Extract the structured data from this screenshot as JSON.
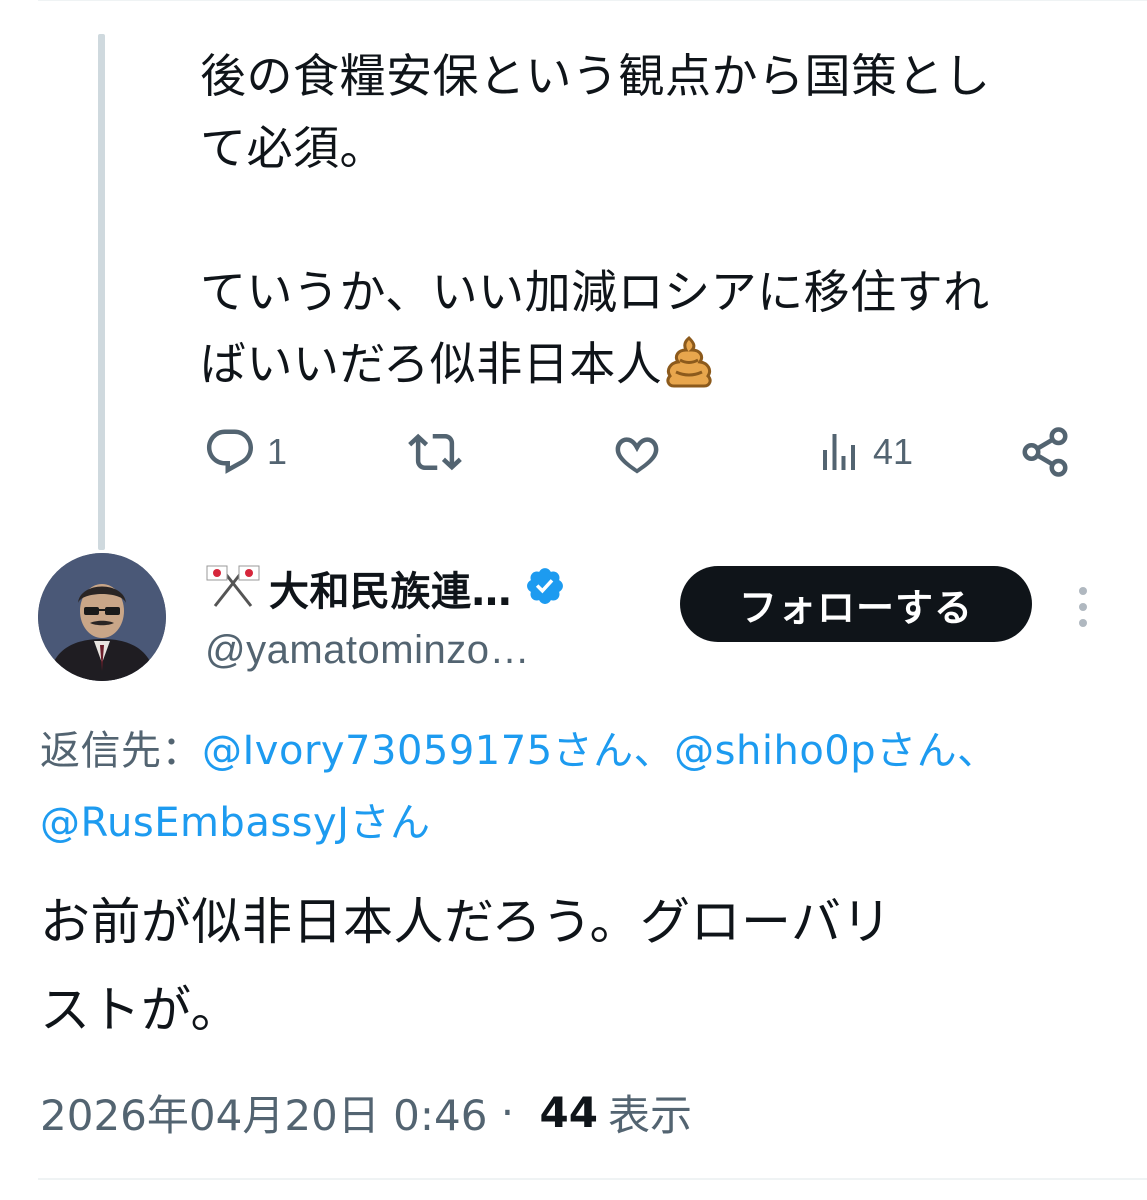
{
  "previous_tweet": {
    "text_lines": [
      "後の食糧安保という観点から国策とし",
      "て必須。",
      "",
      "ていうか、いい加減ロシアに移住すれ",
      "ばいいだろ似非日本人"
    ],
    "emoji": "poop-emoji",
    "actions": {
      "reply_count": "1",
      "retweet_count": "",
      "like_count": "",
      "views_count": "41"
    }
  },
  "reply": {
    "author": {
      "display_name": "大和民族連…",
      "handle": "@yamatominzo…",
      "verified": true
    },
    "follow_label": "フォローする",
    "reply_to": {
      "prefix": "返信先：",
      "mention1": "@Ivory73059175さん",
      "sep1": "、",
      "mention2": "@shiho0pさん",
      "sep2": "、",
      "mention3": "@RusEmbassyJさん"
    },
    "text_lines": [
      "お前が似非日本人だろう。グローバリ",
      "ストが。"
    ],
    "timestamp": "2026年04月20日 0:46",
    "separator": " · ",
    "views_count": "44",
    "views_label": "表示"
  },
  "colors": {
    "link": "#1d9bf0",
    "secondary_text": "#536471",
    "primary_text": "#0f1419",
    "thread_line": "#cfd9de"
  }
}
